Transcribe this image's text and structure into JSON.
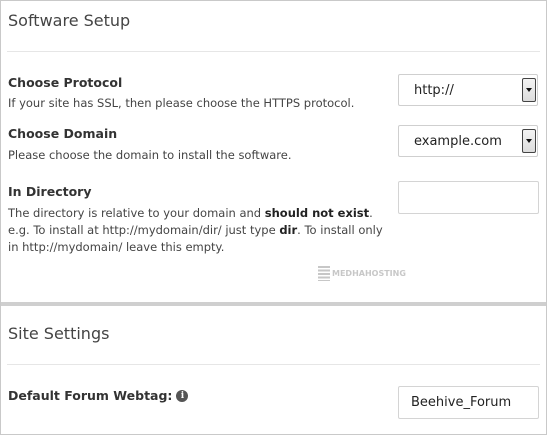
{
  "software_setup": {
    "title": "Software Setup",
    "protocol": {
      "label": "Choose Protocol",
      "help": "If your site has SSL, then please choose the HTTPS protocol.",
      "selected": "http://"
    },
    "domain": {
      "label": "Choose Domain",
      "help": "Please choose the domain to install the software.",
      "selected": "example.com"
    },
    "directory": {
      "label": "In Directory",
      "help_part1": "The directory is relative to your domain and ",
      "help_bold1": "should not exist",
      "help_part2": ". e.g. To install at http://mydomain/dir/ just type ",
      "help_bold2": "dir",
      "help_part3": ". To install only in http://mydomain/ leave this empty.",
      "value": ""
    },
    "watermark_text": "MEDHAHOSTING"
  },
  "site_settings": {
    "title": "Site Settings",
    "webtag": {
      "label": "Default Forum Webtag:",
      "value": "Beehive_Forum",
      "icon": "info-icon"
    }
  }
}
